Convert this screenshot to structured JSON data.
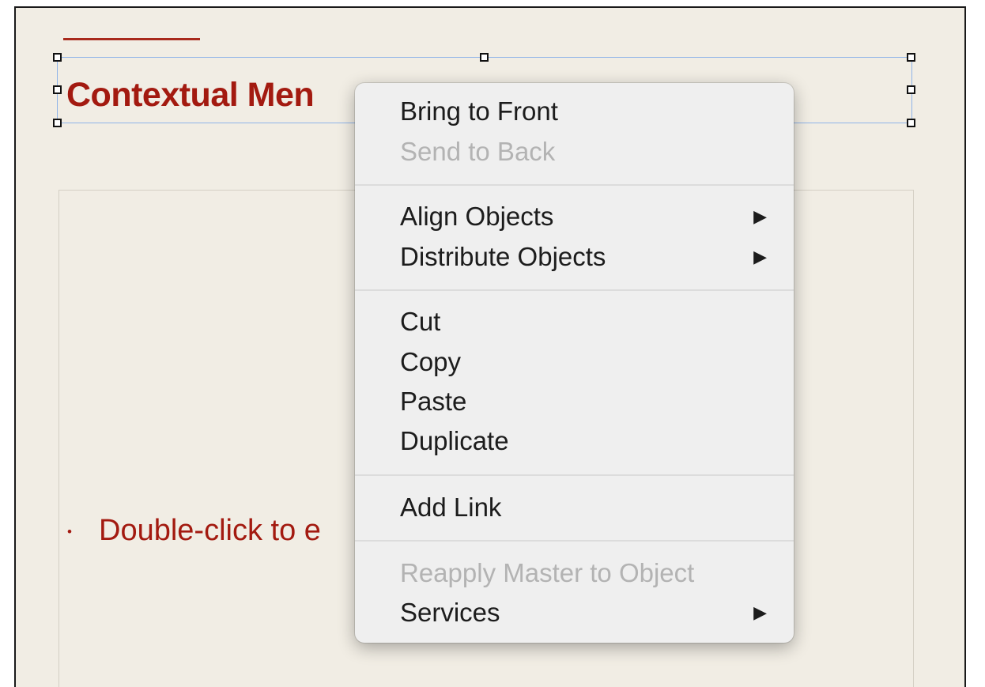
{
  "slide": {
    "title": "Contextual Men",
    "bullet_symbol": "•",
    "body_text": "Double-click to e"
  },
  "context_menu": {
    "items": [
      {
        "label": "Bring to Front",
        "enabled": true,
        "submenu": false
      },
      {
        "label": "Send to Back",
        "enabled": false,
        "submenu": false
      },
      {
        "label": "Align Objects",
        "enabled": true,
        "submenu": true
      },
      {
        "label": "Distribute Objects",
        "enabled": true,
        "submenu": true
      },
      {
        "label": "Cut",
        "enabled": true,
        "submenu": false
      },
      {
        "label": "Copy",
        "enabled": true,
        "submenu": false
      },
      {
        "label": "Paste",
        "enabled": true,
        "submenu": false
      },
      {
        "label": "Duplicate",
        "enabled": true,
        "submenu": false
      },
      {
        "label": "Add Link",
        "enabled": true,
        "submenu": false
      },
      {
        "label": "Reapply Master to Object",
        "enabled": false,
        "submenu": false
      },
      {
        "label": "Services",
        "enabled": true,
        "submenu": true
      }
    ],
    "submenu_arrow": "▶"
  },
  "colors": {
    "accent": "#a31a10",
    "canvas": "#f1ede4",
    "selection": "#8fb3e8",
    "menu_bg": "#efefef",
    "disabled_text": "#b3b3b3"
  }
}
